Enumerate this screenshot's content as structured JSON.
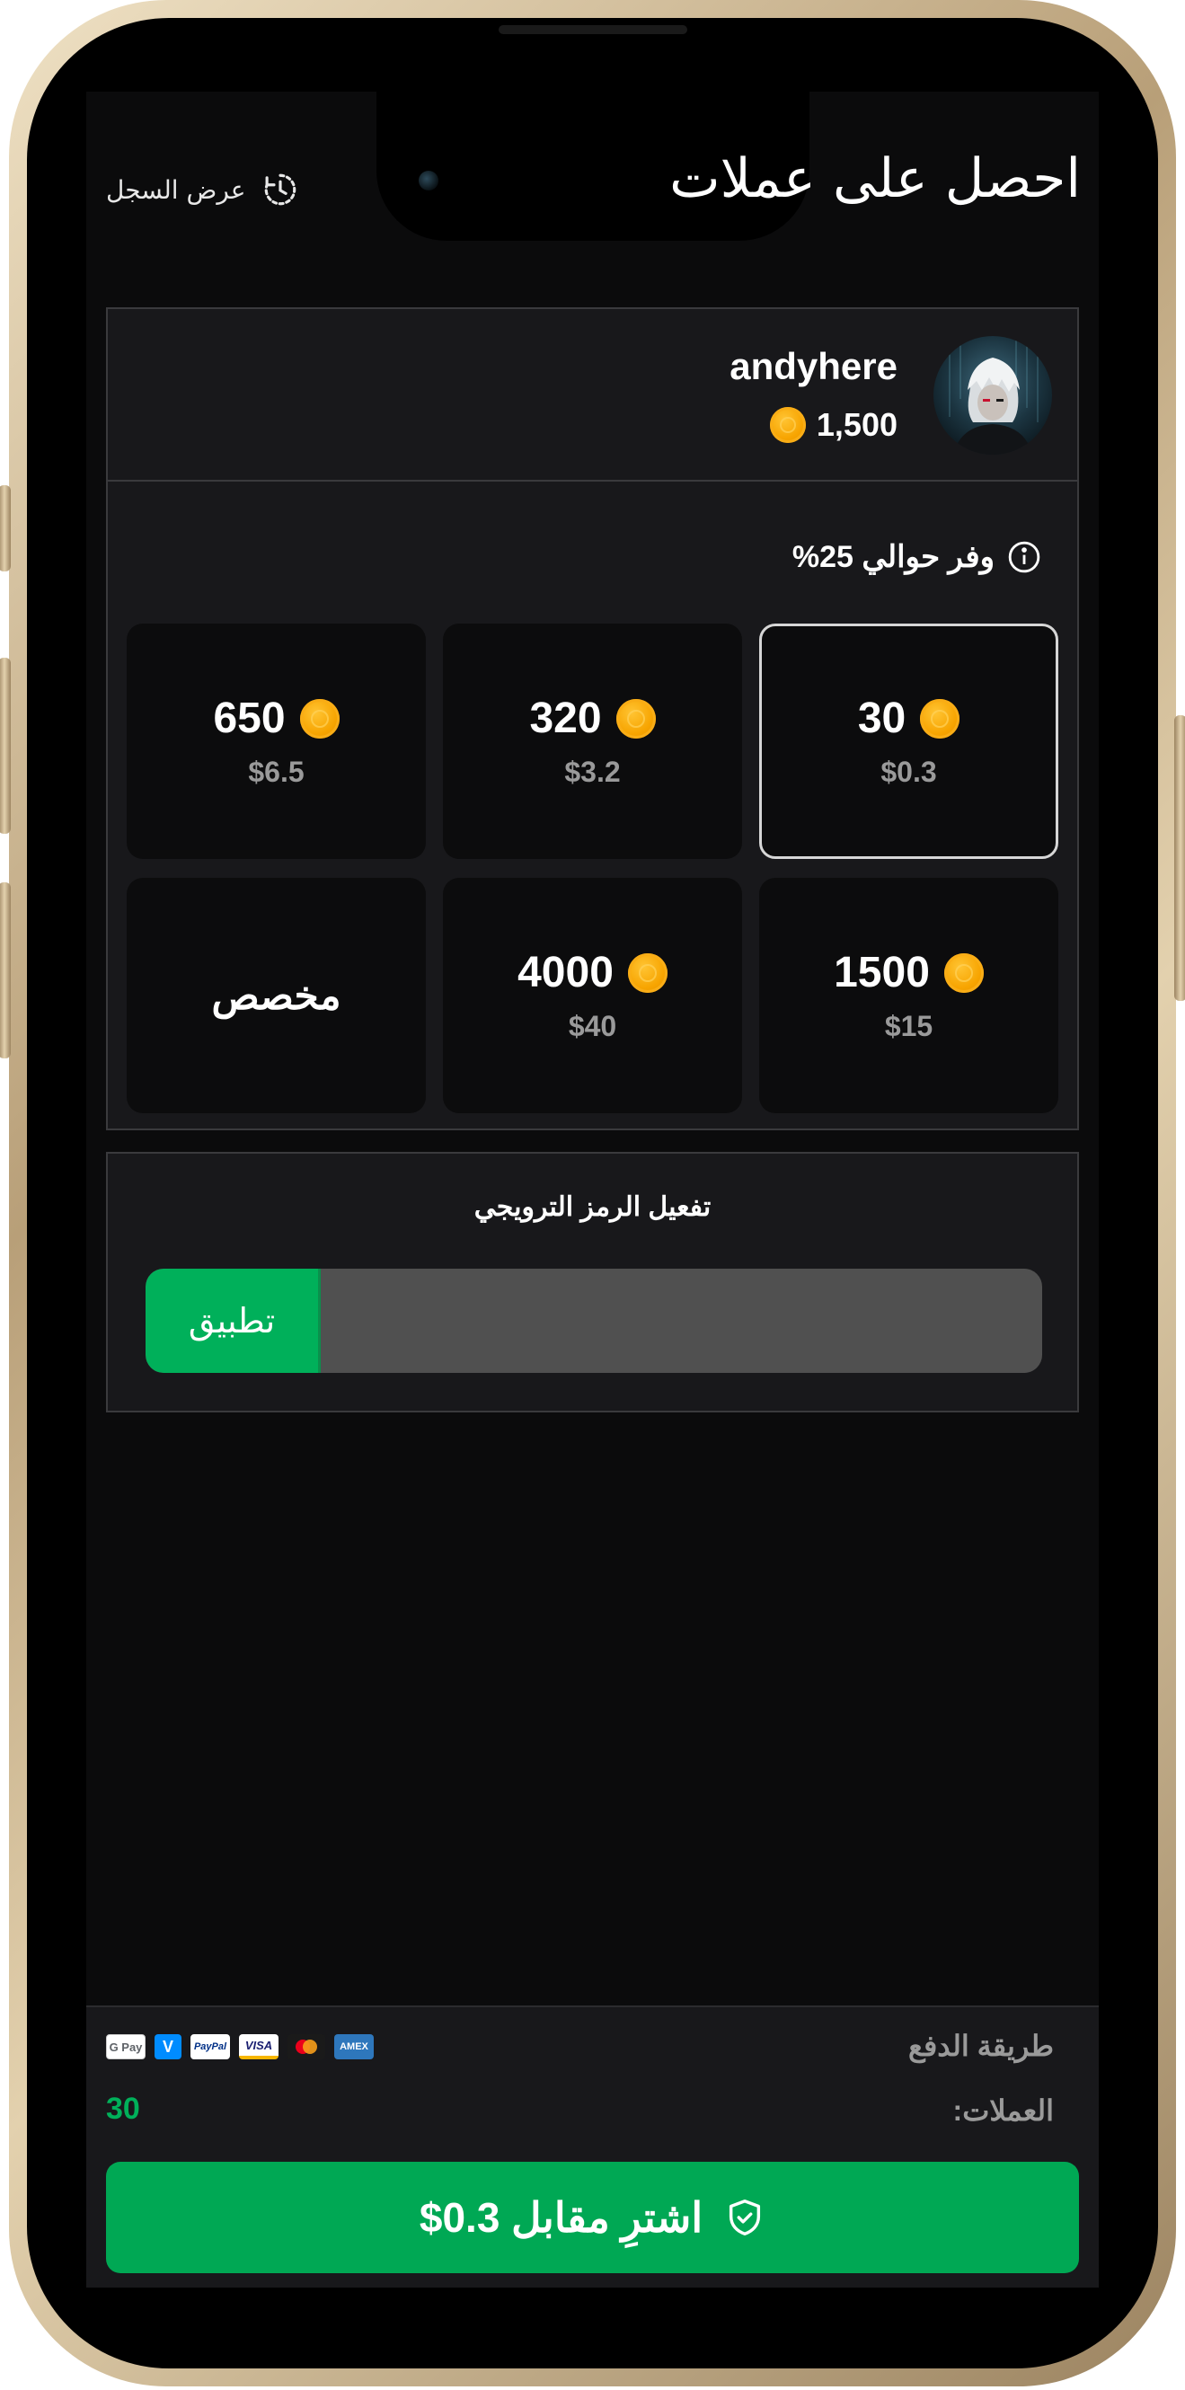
{
  "header": {
    "title": "احصل على عملات",
    "history_label": "عرض السجل"
  },
  "profile": {
    "username": "andyhere",
    "balance": "1,500"
  },
  "savings": {
    "text": "وفر حوالي 25%"
  },
  "packages": [
    {
      "coins": "30",
      "price": "$0.3",
      "selected": true
    },
    {
      "coins": "320",
      "price": "$3.2",
      "selected": false
    },
    {
      "coins": "650",
      "price": "$6.5",
      "selected": false
    },
    {
      "coins": "1500",
      "price": "$15",
      "selected": false
    },
    {
      "coins": "4000",
      "price": "$40",
      "selected": false
    },
    {
      "custom_label": "مخصص",
      "selected": false
    }
  ],
  "promo": {
    "title": "تفعيل الرمز الترويجي",
    "apply_label": "تطبيق",
    "input_value": ""
  },
  "footer": {
    "payment_label": "طريقة الدفع",
    "payment_icons": [
      "google-pay-icon",
      "venmo-icon",
      "paypal-icon",
      "visa-icon",
      "mastercard-icon",
      "amex-icon"
    ],
    "payment_icon_text": {
      "gpay": "G Pay",
      "venmo": "V",
      "paypal": "PayPal",
      "visa": "VISA",
      "amex": "AMEX"
    },
    "coins_label": "العملات:",
    "coins_value": "30",
    "buy_label": "اشترِ مقابل 0.3$"
  },
  "colors": {
    "accent_green": "#00b05a",
    "coin_gold": "#f7a400",
    "panel_bg": "#18181b",
    "screen_bg": "#0b0b0c"
  }
}
